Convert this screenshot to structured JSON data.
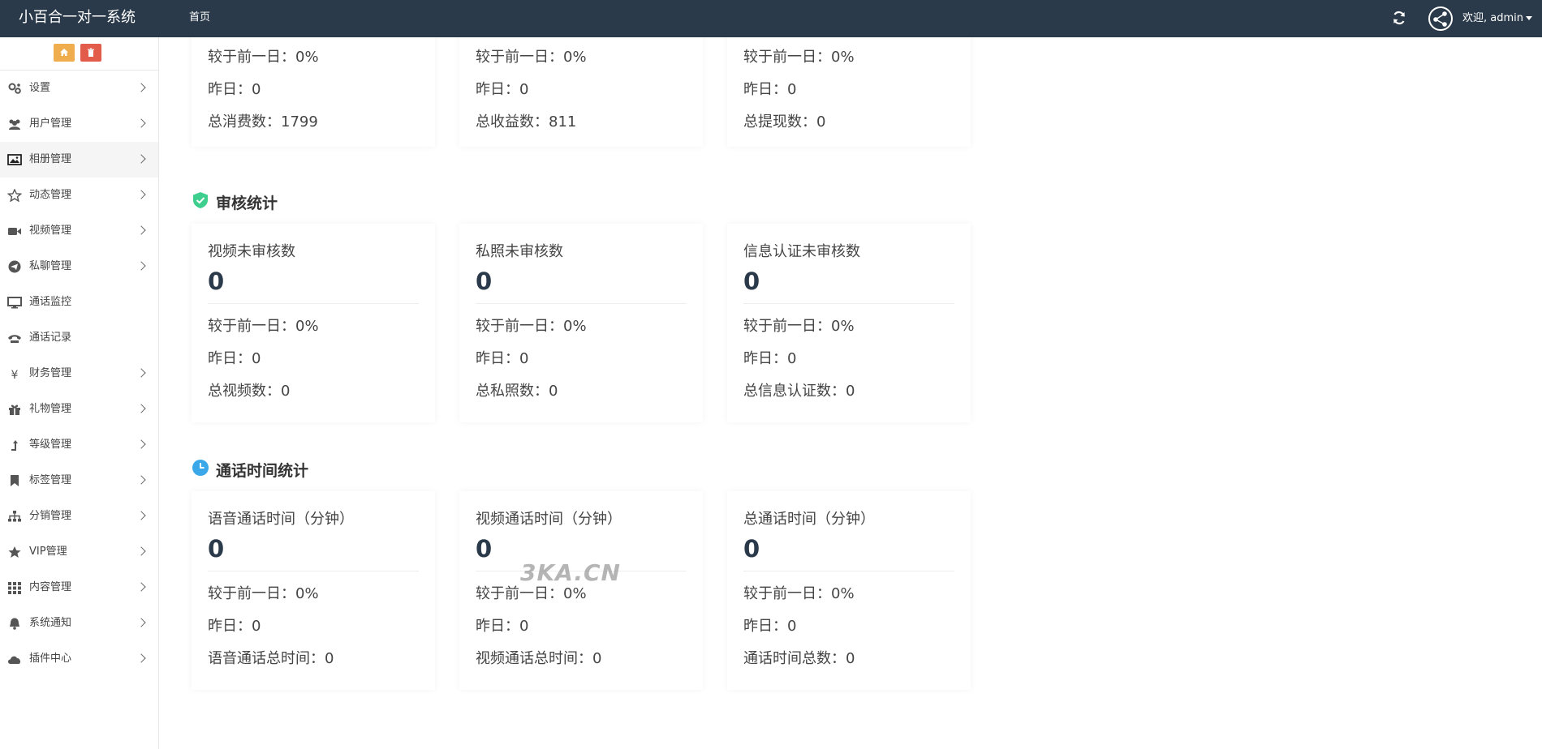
{
  "topbar": {
    "brand": "小百合一对一系统",
    "home": "首页",
    "welcome": "欢迎, admin"
  },
  "sidebar": {
    "items": [
      {
        "label": "设置",
        "icon": "gears-icon",
        "chevron": true
      },
      {
        "label": "用户管理",
        "icon": "users-icon",
        "chevron": true
      },
      {
        "label": "相册管理",
        "icon": "image-icon",
        "chevron": true,
        "active": true
      },
      {
        "label": "动态管理",
        "icon": "star-outline-icon",
        "chevron": true
      },
      {
        "label": "视频管理",
        "icon": "video-camera-icon",
        "chevron": true
      },
      {
        "label": "私聊管理",
        "icon": "paper-plane-icon",
        "chevron": true
      },
      {
        "label": "通话监控",
        "icon": "monitor-icon",
        "chevron": false
      },
      {
        "label": "通话记录",
        "icon": "phone-icon",
        "chevron": false
      },
      {
        "label": "财务管理",
        "icon": "yen-icon",
        "chevron": true
      },
      {
        "label": "礼物管理",
        "icon": "gift-icon",
        "chevron": true
      },
      {
        "label": "等级管理",
        "icon": "level-up-icon",
        "chevron": true
      },
      {
        "label": "标签管理",
        "icon": "bookmark-icon",
        "chevron": true
      },
      {
        "label": "分销管理",
        "icon": "sitemap-icon",
        "chevron": true
      },
      {
        "label": "VIP管理",
        "icon": "star-icon",
        "chevron": true
      },
      {
        "label": "内容管理",
        "icon": "grid-icon",
        "chevron": true
      },
      {
        "label": "系统通知",
        "icon": "bell-icon",
        "chevron": true
      },
      {
        "label": "插件中心",
        "icon": "cloud-icon",
        "chevron": true
      }
    ]
  },
  "top_cards": [
    {
      "compare": "较于前一日：0%",
      "yesterday": "昨日：0",
      "total": "总消费数：1799"
    },
    {
      "compare": "较于前一日：0%",
      "yesterday": "昨日：0",
      "total": "总收益数：811"
    },
    {
      "compare": "较于前一日：0%",
      "yesterday": "昨日：0",
      "total": "总提现数：0"
    }
  ],
  "audit": {
    "title": "审核统计",
    "icon": "shield-check-icon",
    "cards": [
      {
        "title": "视频未审核数",
        "value": "0",
        "compare": "较于前一日：0%",
        "yesterday": "昨日：0",
        "total": "总视频数：0"
      },
      {
        "title": "私照未审核数",
        "value": "0",
        "compare": "较于前一日：0%",
        "yesterday": "昨日：0",
        "total": "总私照数：0"
      },
      {
        "title": "信息认证未审核数",
        "value": "0",
        "compare": "较于前一日：0%",
        "yesterday": "昨日：0",
        "total": "总信息认证数：0"
      }
    ]
  },
  "call_time": {
    "title": "通话时间统计",
    "icon": "clock-icon",
    "cards": [
      {
        "title": "语音通话时间（分钟）",
        "value": "0",
        "compare": "较于前一日：0%",
        "yesterday": "昨日：0",
        "total": "语音通话总时间：0"
      },
      {
        "title": "视频通话时间（分钟）",
        "value": "0",
        "compare": "较于前一日：0%",
        "yesterday": "昨日：0",
        "total": "视频通话总时间：0"
      },
      {
        "title": "总通话时间（分钟）",
        "value": "0",
        "compare": "较于前一日：0%",
        "yesterday": "昨日：0",
        "total": "通话时间总数：0"
      }
    ]
  },
  "watermark": "3KA.CN",
  "colors": {
    "topbar": "#2b3a4a",
    "home_button": "#f0ad4e",
    "delete_button": "#e35b4a",
    "audit_icon": "#3ecf8e",
    "clock_icon": "#3aa8e8"
  }
}
